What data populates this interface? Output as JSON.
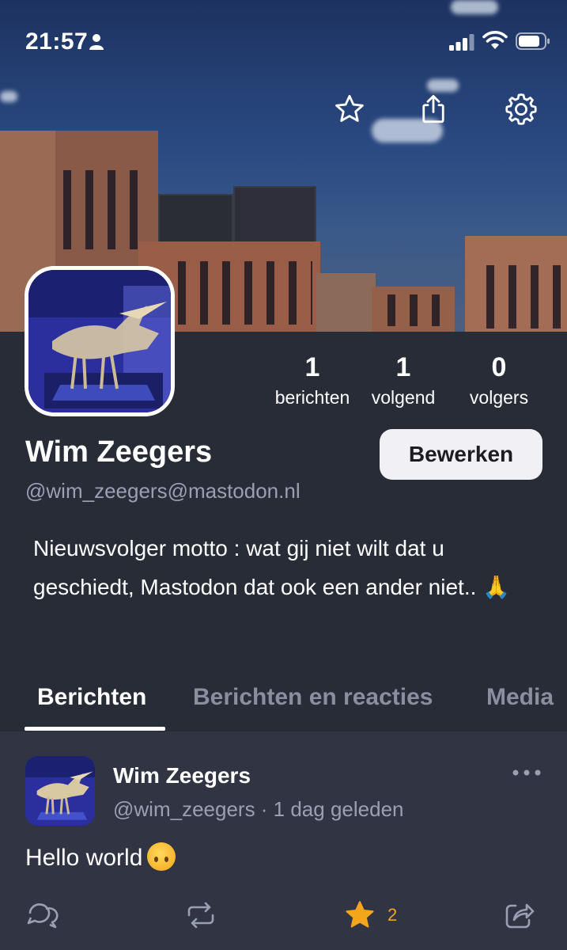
{
  "status_bar": {
    "time": "21:57"
  },
  "header_actions": [
    "star-icon",
    "share-icon",
    "gear-icon"
  ],
  "profile": {
    "display_name": "Wim Zeegers",
    "handle": "@wim_zeegers@mastodon.nl",
    "edit_label": "Bewerken",
    "bio": "Nieuwsvolger motto : wat gij niet wilt dat u geschiedt, Mastodon dat ook een ander niet.. 🙏",
    "stats": [
      {
        "value": "1",
        "label": "berichten"
      },
      {
        "value": "1",
        "label": "volgend"
      },
      {
        "value": "0",
        "label": "volgers"
      }
    ]
  },
  "tabs": [
    {
      "label": "Berichten",
      "active": true
    },
    {
      "label": "Berichten en reacties",
      "active": false
    },
    {
      "label": "Media",
      "active": false
    }
  ],
  "post": {
    "author": "Wim Zeegers",
    "meta": "@wim_zeegers · 1 dag geleden",
    "text": "Hello world",
    "favourites": "2"
  },
  "colors": {
    "background": "#282c37",
    "post_background": "#313543",
    "accent": "#f3a51c",
    "muted": "#9aa0b4"
  }
}
